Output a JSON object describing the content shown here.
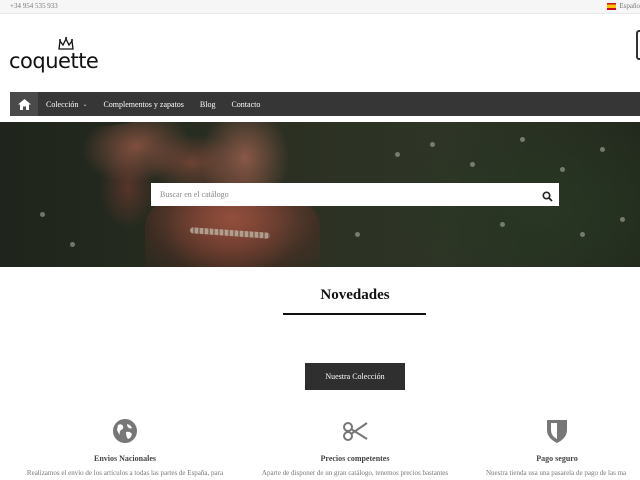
{
  "topbar": {
    "phone": "+34 954 535 933",
    "language": "Españo"
  },
  "brand": {
    "logo_text": "coquette"
  },
  "nav": {
    "home_icon": "home-icon",
    "items": [
      {
        "label": "Colección",
        "has_dropdown": true
      },
      {
        "label": "Complementos y zapatos"
      },
      {
        "label": "Blog"
      },
      {
        "label": "Contacto"
      }
    ]
  },
  "search": {
    "placeholder": "Buscar en el catálogo",
    "icon": "search-icon"
  },
  "section": {
    "title": "Novedades",
    "button_label": "Nuestra Colección"
  },
  "features": [
    {
      "icon": "globe-icon",
      "title": "Envios Nacionales",
      "text": "Realizamos el envío de los artículos a todas las partes de España, para"
    },
    {
      "icon": "scissors-icon",
      "title": "Precios competentes",
      "text": "Aparte de disponer de un gran catálogo, tenemos precios bastantes"
    },
    {
      "icon": "shield-icon",
      "title": "Pago seguro",
      "text": "Nuestra tienda usa una pasarela de pago de las ma"
    }
  ],
  "colors": {
    "nav_bg": "#363636",
    "button_bg": "#2f2f2f",
    "icon_gray": "#777777"
  }
}
